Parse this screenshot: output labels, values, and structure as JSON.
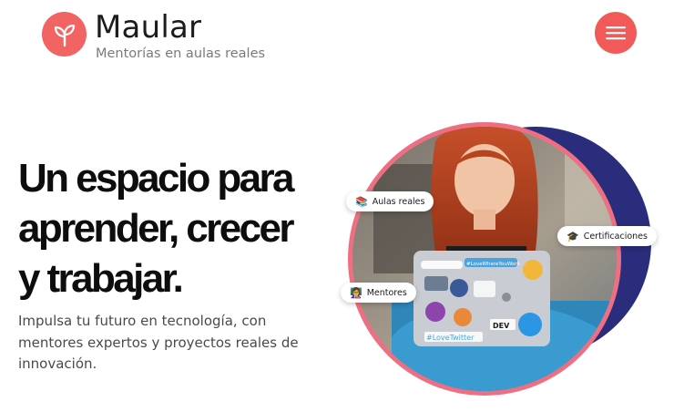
{
  "header": {
    "brand_name": "Maular",
    "tagline": "Mentorías en aulas reales",
    "brand_color": "#f26464",
    "menu_icon": "hamburger-icon"
  },
  "hero": {
    "title_lines": [
      "Un espacio para",
      "aprender, crecer",
      "y trabajar."
    ],
    "description_lines": [
      "Impulsa tu futuro en tecnología, con",
      "mentores expertos y proyectos reales de",
      "innovación."
    ]
  },
  "badges": {
    "aulas": {
      "label": "Aulas reales",
      "icon": "books-icon",
      "emoji": "📚"
    },
    "certificaciones": {
      "label": "Certificaciones",
      "icon": "graduation-cap-icon",
      "emoji": "🎓"
    },
    "mentores": {
      "label": "Mentores",
      "icon": "mentor-icon",
      "emoji": "👩‍🏫"
    }
  },
  "laptop": {
    "stickers": [
      "#LoveWhereYouWork",
      "#LoveTwitter",
      "DEV"
    ]
  },
  "colors": {
    "accent": "#f25a5a",
    "ring_pink": "#ef6f82",
    "ring_navy": "#2a2d7c",
    "text_dark": "#0d0d0d",
    "text_muted": "#4a4a4a"
  }
}
